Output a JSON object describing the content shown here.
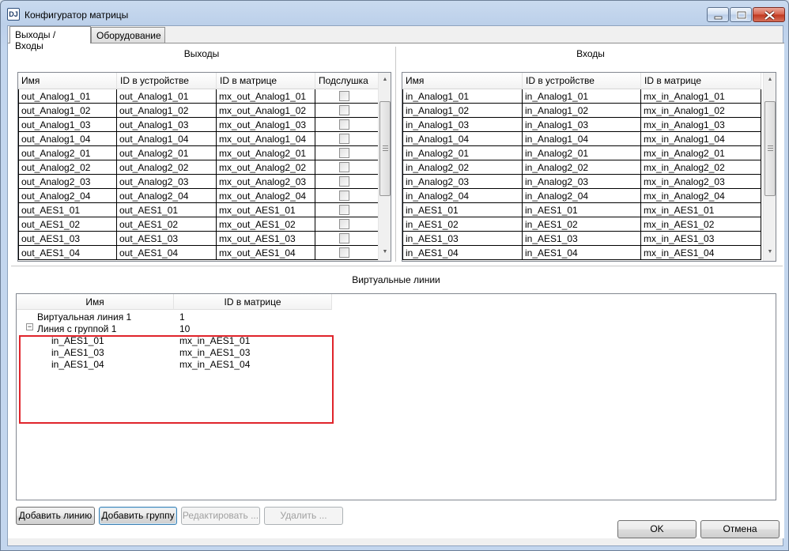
{
  "window": {
    "title": "Конфигуратор матрицы",
    "app_icon_text": "DJ"
  },
  "tabs": [
    {
      "label": "Выходы / Входы",
      "active": true
    },
    {
      "label": "Оборудование",
      "active": false
    }
  ],
  "outputs": {
    "title": "Выходы",
    "columns": [
      "Имя",
      "ID в устройстве",
      "ID в матрице",
      "Подслушка"
    ],
    "rows": [
      [
        "out_Analog1_01",
        "out_Analog1_01",
        "mx_out_Analog1_01"
      ],
      [
        "out_Analog1_02",
        "out_Analog1_02",
        "mx_out_Analog1_02"
      ],
      [
        "out_Analog1_03",
        "out_Analog1_03",
        "mx_out_Analog1_03"
      ],
      [
        "out_Analog1_04",
        "out_Analog1_04",
        "mx_out_Analog1_04"
      ],
      [
        "out_Analog2_01",
        "out_Analog2_01",
        "mx_out_Analog2_01"
      ],
      [
        "out_Analog2_02",
        "out_Analog2_02",
        "mx_out_Analog2_02"
      ],
      [
        "out_Analog2_03",
        "out_Analog2_03",
        "mx_out_Analog2_03"
      ],
      [
        "out_Analog2_04",
        "out_Analog2_04",
        "mx_out_Analog2_04"
      ],
      [
        "out_AES1_01",
        "out_AES1_01",
        "mx_out_AES1_01"
      ],
      [
        "out_AES1_02",
        "out_AES1_02",
        "mx_out_AES1_02"
      ],
      [
        "out_AES1_03",
        "out_AES1_03",
        "mx_out_AES1_03"
      ],
      [
        "out_AES1_04",
        "out_AES1_04",
        "mx_out_AES1_04"
      ]
    ]
  },
  "inputs": {
    "title": "Входы",
    "columns": [
      "Имя",
      "ID в устройстве",
      "ID в матрице"
    ],
    "rows": [
      [
        "in_Analog1_01",
        "in_Analog1_01",
        "mx_in_Analog1_01"
      ],
      [
        "in_Analog1_02",
        "in_Analog1_02",
        "mx_in_Analog1_02"
      ],
      [
        "in_Analog1_03",
        "in_Analog1_03",
        "mx_in_Analog1_03"
      ],
      [
        "in_Analog1_04",
        "in_Analog1_04",
        "mx_in_Analog1_04"
      ],
      [
        "in_Analog2_01",
        "in_Analog2_01",
        "mx_in_Analog2_01"
      ],
      [
        "in_Analog2_02",
        "in_Analog2_02",
        "mx_in_Analog2_02"
      ],
      [
        "in_Analog2_03",
        "in_Analog2_03",
        "mx_in_Analog2_03"
      ],
      [
        "in_Analog2_04",
        "in_Analog2_04",
        "mx_in_Analog2_04"
      ],
      [
        "in_AES1_01",
        "in_AES1_01",
        "mx_in_AES1_01"
      ],
      [
        "in_AES1_02",
        "in_AES1_02",
        "mx_in_AES1_02"
      ],
      [
        "in_AES1_03",
        "in_AES1_03",
        "mx_in_AES1_03"
      ],
      [
        "in_AES1_04",
        "in_AES1_04",
        "mx_in_AES1_04"
      ]
    ]
  },
  "virtual_lines": {
    "title": "Виртуальные линии",
    "columns": [
      "Имя",
      "ID в матрице"
    ],
    "items": [
      {
        "name": "Виртуальная линия 1",
        "id": "1",
        "level": 0,
        "expandable": false
      },
      {
        "name": "Линия с группой 1",
        "id": "10",
        "level": 0,
        "expandable": true,
        "expanded": true,
        "expander_symbol": "−"
      },
      {
        "name": "in_AES1_01",
        "id": "mx_in_AES1_01",
        "level": 1
      },
      {
        "name": "in_AES1_03",
        "id": "mx_in_AES1_03",
        "level": 1
      },
      {
        "name": "in_AES1_04",
        "id": "mx_in_AES1_04",
        "level": 1
      }
    ]
  },
  "buttons": {
    "add_line": "Добавить линию",
    "add_group": "Добавить группу",
    "edit": "Редактировать ...",
    "delete": "Удалить ...",
    "ok": "OK",
    "cancel": "Отмена"
  },
  "colors": {
    "highlight": "#e0242b"
  }
}
